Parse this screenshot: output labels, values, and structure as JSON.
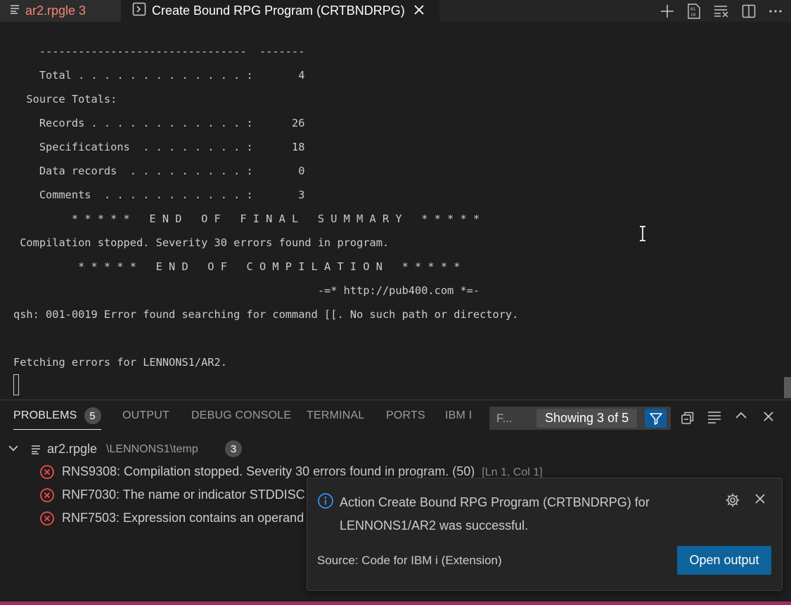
{
  "tabs": [
    {
      "label": "ar2.rpgle 3",
      "state": "modified-error",
      "color": "#f48771"
    },
    {
      "label": "Create Bound RPG Program (CRTBNDRPG)",
      "state": "active"
    }
  ],
  "tab_actions": [
    "plus-icon",
    "binary-icon",
    "clear-icon",
    "split-editor-icon",
    "more-icon"
  ],
  "terminal": {
    "lines": [
      "    --------------------------------  -------",
      "    Total . . . . . . . . . . . . . :       4",
      "  Source Totals:",
      "    Records . . . . . . . . . . . . :      26",
      "    Specifications  . . . . . . . . :      18",
      "    Data records  . . . . . . . . . :       0",
      "    Comments  . . . . . . . . . . . :       3",
      "         * * * * *   E N D   O F   F I N A L   S U M M A R Y   * * * * *",
      " Compilation stopped. Severity 30 errors found in program.",
      "          * * * * *   E N D   O F   C O M P I L A T I O N   * * * * *",
      "                                               -=* http://pub400.com *=-",
      "qsh: 001-0019 Error found searching for command [[. No such path or directory.",
      "",
      "Fetching errors for LENNONS1/AR2."
    ]
  },
  "panel": {
    "tabs": [
      {
        "label": "PROBLEMS",
        "badge": "5",
        "active": true
      },
      {
        "label": "OUTPUT"
      },
      {
        "label": "DEBUG CONSOLE"
      },
      {
        "label": "TERMINAL"
      },
      {
        "label": "PORTS"
      },
      {
        "label": "IBM I"
      }
    ],
    "filter": {
      "placeholder": "F...",
      "count": "Showing 3 of 5"
    },
    "file": {
      "name": "ar2.rpgle",
      "path": "\\LENNONS1\\temp",
      "count": "3"
    },
    "problems": [
      {
        "text": "RNS9308: Compilation stopped. Severity 30 errors found in program. (50)",
        "location": "[Ln 1, Col 1]"
      },
      {
        "text": "RNF7030: The name or indicator STDDISC",
        "location": ""
      },
      {
        "text": "RNF7503: Expression contains an operand",
        "location": ""
      }
    ]
  },
  "notification": {
    "message": "Action Create Bound RPG Program (CRTBNDRPG) for LENNONS1/AR2 was successful.",
    "source": "Source: Code for IBM i (Extension)",
    "button": "Open output"
  },
  "colors": {
    "accent": "#0e639c",
    "error": "#f14c4c",
    "info": "#3794ff",
    "statusbar": "#9b2c67"
  }
}
